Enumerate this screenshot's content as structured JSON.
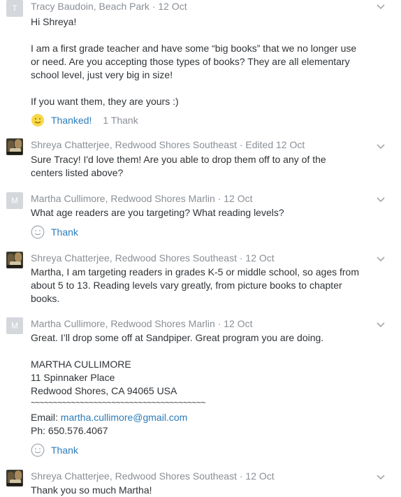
{
  "posts": [
    {
      "avatar_letter": "T",
      "author": "Tracy Baudoin, Beach Park",
      "separator": " · ",
      "date": "12 Oct",
      "lines": [
        "Hi Shreya!",
        "I am a first grade teacher and have some “big books” that we no longer use",
        "or need. Are you accepting those types of books? They are all elementary",
        "school level, just very big in size!",
        "If you want them, they are yours :)"
      ],
      "thank_label": "Thanked!",
      "thank_count": "1 Thank"
    },
    {
      "author": "Shreya Chatterjee, Redwood Shores Southeast",
      "separator": " · ",
      "date": "Edited 12 Oct",
      "lines": [
        "Sure Tracy! I'd love them! Are you able to drop them off to any of the",
        "centers listed above?"
      ]
    },
    {
      "avatar_letter": "M",
      "author": "Martha Cullimore, Redwood Shores Marlin",
      "separator": " · ",
      "date": "12 Oct",
      "lines": [
        "What age readers are you targeting?  What reading levels?"
      ],
      "thank_label": "Thank"
    },
    {
      "author": "Shreya Chatterjee, Redwood Shores Southeast",
      "separator": " · ",
      "date": "12 Oct",
      "lines": [
        "Martha, I am targeting readers in grades K-5 or middle school, so ages from",
        "about 5 to 13. Reading levels vary greatly, from picture books to chapter",
        "books."
      ]
    },
    {
      "avatar_letter": "M",
      "author": "Martha Cullimore, Redwood Shores Marlin",
      "separator": " · ",
      "date": "12 Oct",
      "lines": [
        "Great. I’ll drop some off at Sandpiper. Great program you are doing.",
        "MARTHA  CULLIMORE",
        "11 Spinnaker Place",
        "Redwood Shores, CA 94065 USA",
        "~~~~~~~~~~~~~~~~~~~~~~~~~~~~~~~~~~~~~~~",
        "Email:",
        "Ph:  650.576.4067"
      ],
      "email": "martha.cullimore@gmail.com",
      "thank_label": "Thank"
    },
    {
      "author": "Shreya Chatterjee, Redwood Shores Southeast",
      "separator": " · ",
      "date": "12 Oct",
      "lines": [
        "Thank you so much Martha!"
      ]
    }
  ]
}
